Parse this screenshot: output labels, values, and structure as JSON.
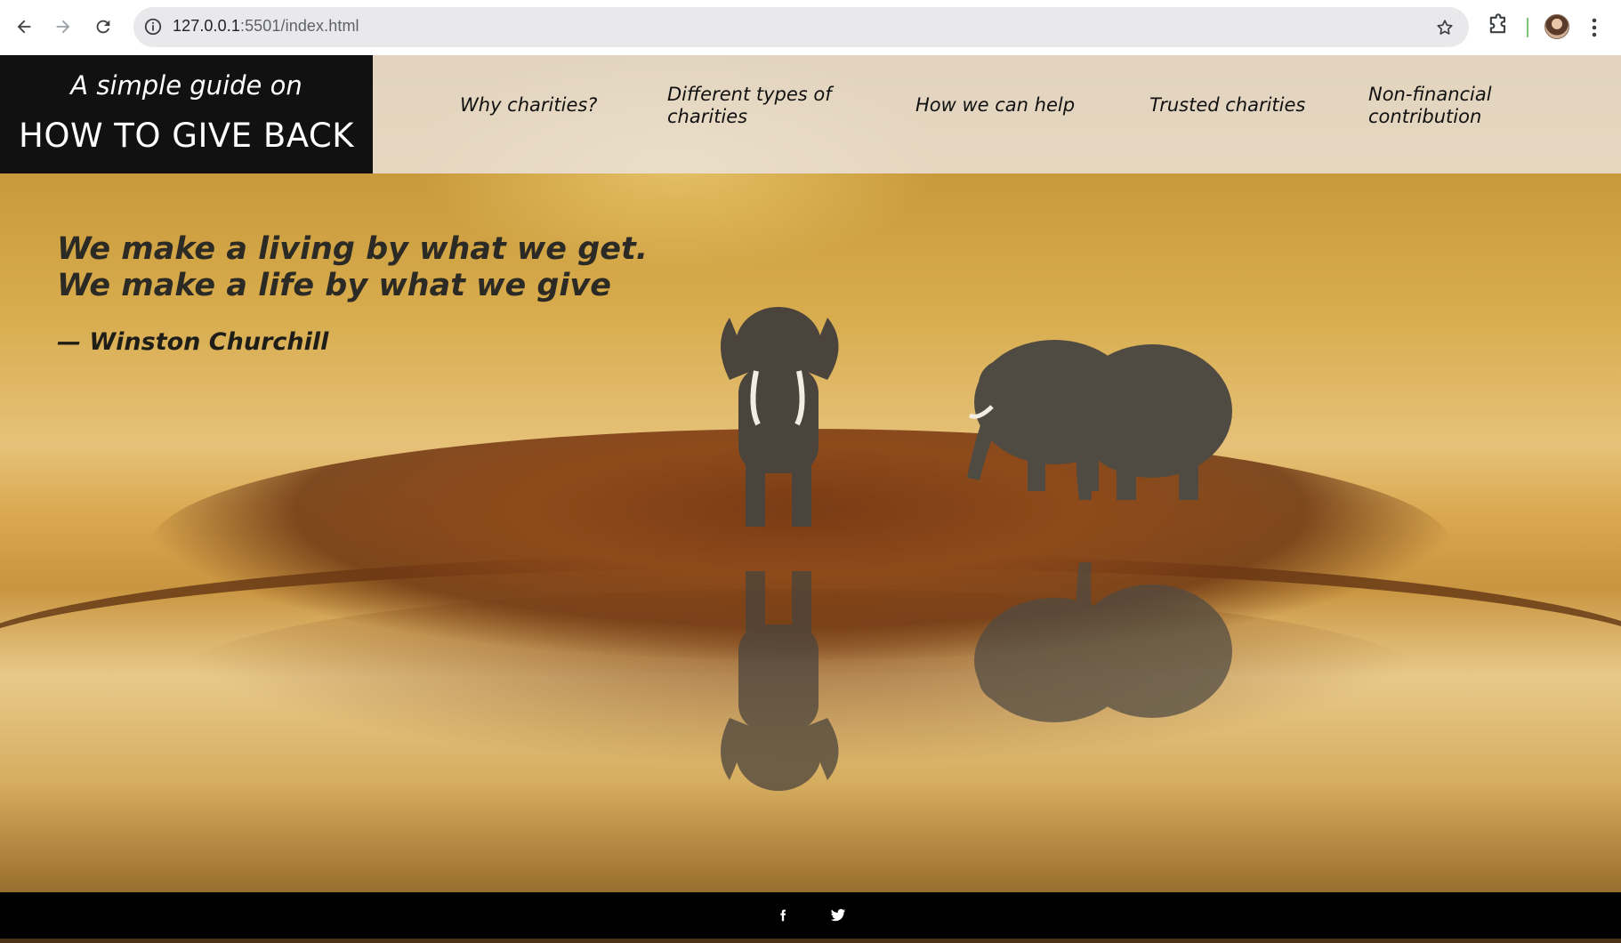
{
  "browser": {
    "url_host": "127.0.0.1",
    "url_rest": ":5501/index.html"
  },
  "site": {
    "logo_subtitle": "A simple guide on",
    "logo_title": "HOW TO GIVE BACK",
    "nav": [
      "Why charities?",
      "Different types of charities",
      "How we can help",
      "Trusted charities",
      "Non-financial contribution"
    ],
    "quote": {
      "line1": "We make a living by what we get.",
      "line2": "We make a life by what we give",
      "author": "— Winston Churchill"
    },
    "footer": {
      "social": [
        "facebook-icon",
        "twitter-icon"
      ]
    }
  }
}
